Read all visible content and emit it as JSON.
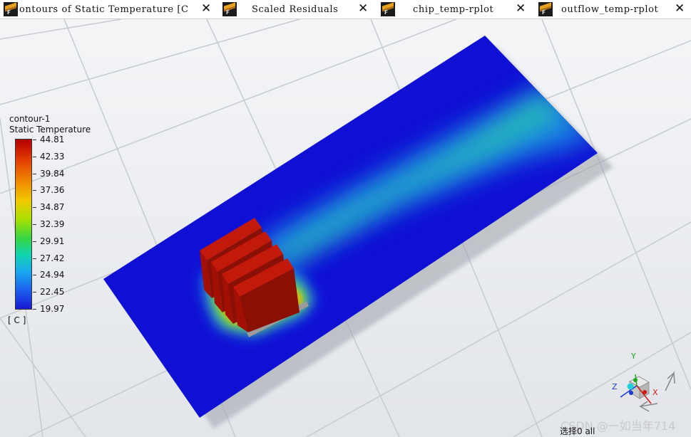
{
  "tabs": [
    {
      "label": "ontours of Static Temperature [C",
      "active": true
    },
    {
      "label": "Scaled Residuals",
      "active": false
    },
    {
      "label": "chip_temp-rplot",
      "active": false
    },
    {
      "label": "outflow_temp-rplot",
      "active": false
    }
  ],
  "close_glyph": "✕",
  "tab_icon_letter": "F",
  "legend": {
    "name": "contour-1",
    "quantity": "Static Temperature",
    "unit": "[ C ]",
    "ticks": [
      "44.81",
      "42.33",
      "39.84",
      "37.36",
      "34.87",
      "32.39",
      "29.91",
      "27.42",
      "24.94",
      "22.45",
      "19.97"
    ]
  },
  "triad": {
    "x_label": "X",
    "y_label": "Y",
    "z_label": "Z"
  },
  "status_text": "选择0 all",
  "watermark": "CSDN @一如当年714",
  "colors": {
    "cold": "#1212d6",
    "hot": "#a80d00",
    "plume": "#2ad8a8"
  }
}
